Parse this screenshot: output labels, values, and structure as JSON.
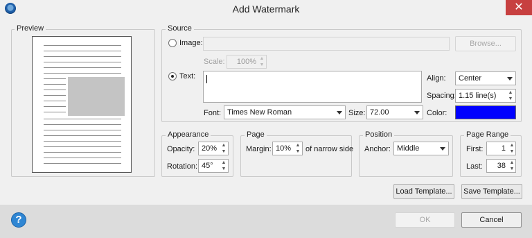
{
  "window": {
    "title": "Add Watermark",
    "close_glyph": "✕"
  },
  "preview": {
    "label": "Preview"
  },
  "source": {
    "label": "Source",
    "image_label": "Image:",
    "image_path": "",
    "browse_label": "Browse...",
    "scale_label": "Scale:",
    "scale_value": "100%",
    "text_label": "Text:",
    "text_value": "",
    "align_label": "Align:",
    "align_value": "Center",
    "spacing_label": "Spacing:",
    "spacing_value": "1.15  line(s)",
    "font_label": "Font:",
    "font_value": "Times New Roman",
    "size_label": "Size:",
    "size_value": "72.00",
    "color_label": "Color:",
    "color_value": "#0000ff"
  },
  "appearance": {
    "label": "Appearance",
    "opacity_label": "Opacity:",
    "opacity_value": "20%",
    "rotation_label": "Rotation:",
    "rotation_value": "45°"
  },
  "page": {
    "label": "Page",
    "margin_label": "Margin:",
    "margin_value": "10%",
    "margin_suffix": "of narrow side"
  },
  "position": {
    "label": "Position",
    "anchor_label": "Anchor:",
    "anchor_value": "Middle"
  },
  "page_range": {
    "label": "Page Range",
    "first_label": "First:",
    "first_value": "1",
    "last_label": "Last:",
    "last_value": "38"
  },
  "buttons": {
    "load_template": "Load Template...",
    "save_template": "Save Template...",
    "ok": "OK",
    "cancel": "Cancel",
    "help_glyph": "?"
  },
  "icons": {
    "app": "watermark-app-icon",
    "close": "close-icon",
    "help": "help-icon",
    "dropdown": "chevron-down-icon",
    "spinner": "spinner-arrows-icon"
  }
}
